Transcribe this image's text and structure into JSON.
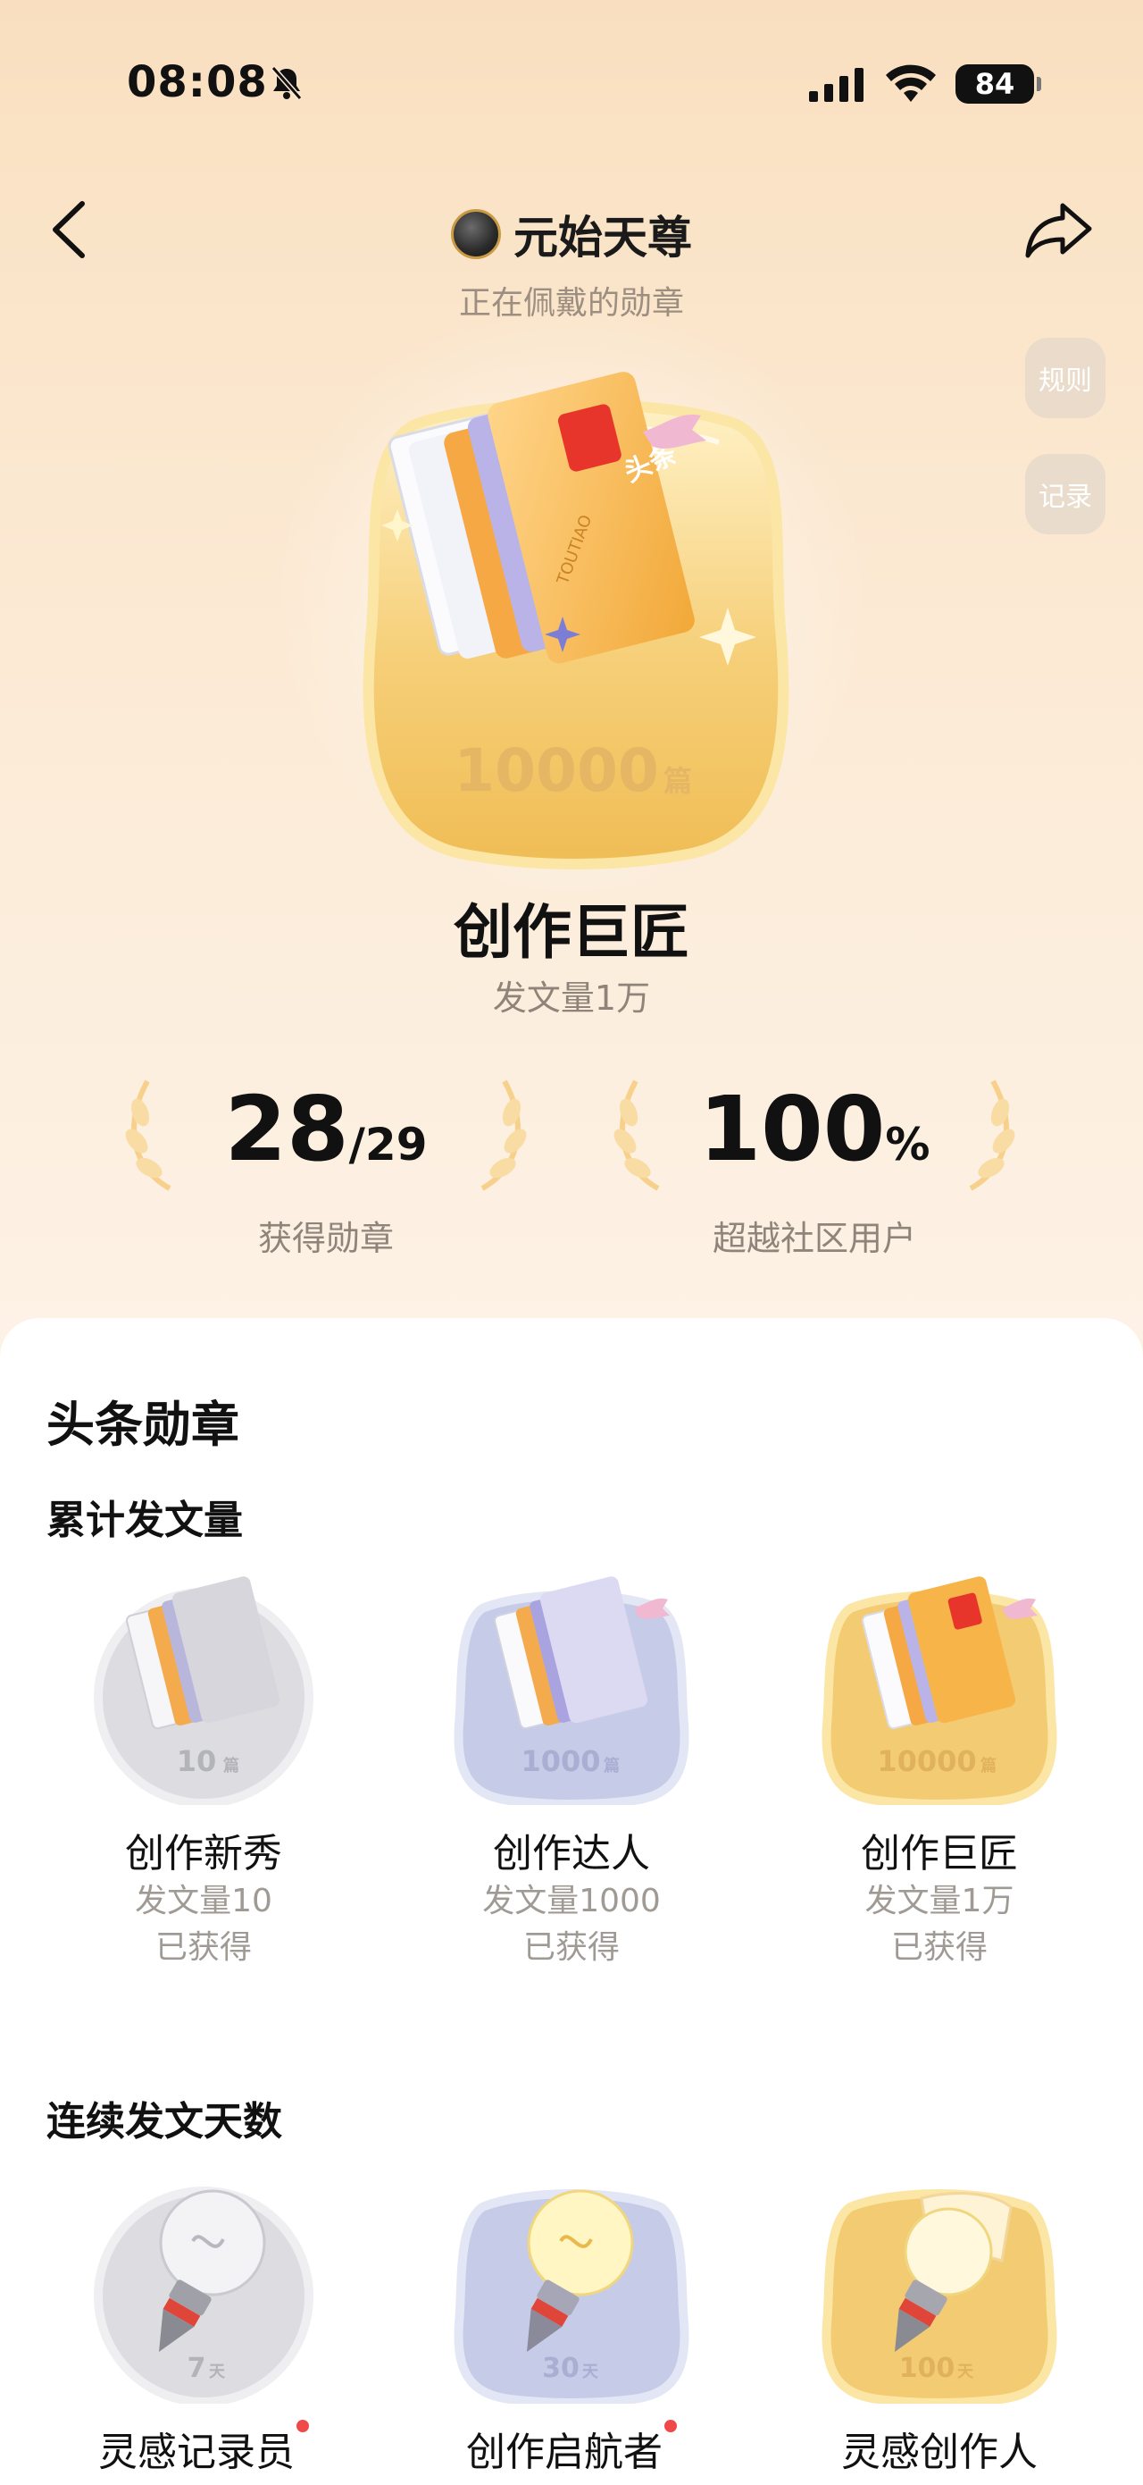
{
  "status_bar": {
    "time": "08:08",
    "battery": "84"
  },
  "header": {
    "username": "元始天尊",
    "wearing_label": "正在佩戴的勋章",
    "rules_button": "规则",
    "records_button": "记录"
  },
  "featured_badge": {
    "plate_label": "10000",
    "plate_unit": "篇",
    "title": "创作巨匠",
    "subtitle": "发文量1万",
    "book_tag": "头条",
    "spine_text": "TOUTIAO"
  },
  "stats": {
    "badges_earned": "28",
    "badges_total": "/29",
    "badges_label": "获得勋章",
    "percentile": "100",
    "percent_sign": "%",
    "percentile_label": "超越社区用户"
  },
  "panel": {
    "section_title": "头条勋章",
    "groups": [
      {
        "title": "累计发文量",
        "badges": [
          {
            "plate": "10",
            "unit": "篇",
            "name": "创作新秀",
            "requirement": "发文量10",
            "status": "已获得",
            "tier": "silver"
          },
          {
            "plate": "1000",
            "unit": "篇",
            "name": "创作达人",
            "requirement": "发文量1000",
            "status": "已获得",
            "tier": "lavender"
          },
          {
            "plate": "10000",
            "unit": "篇",
            "name": "创作巨匠",
            "requirement": "发文量1万",
            "status": "已获得",
            "tier": "gold"
          }
        ]
      },
      {
        "title": "连续发文天数",
        "badges": [
          {
            "plate": "7",
            "unit": "天",
            "name": "灵感记录员",
            "tier": "silver"
          },
          {
            "plate": "30",
            "unit": "天",
            "name": "创作启航者",
            "tier": "lavender"
          },
          {
            "plate": "100",
            "unit": "天",
            "name": "灵感创作人",
            "tier": "gold"
          }
        ]
      }
    ]
  },
  "colors": {
    "gold": "#f2c56a",
    "lavender": "#c9cde8",
    "silver": "#d8d8dc",
    "notify": "#f0494a"
  }
}
